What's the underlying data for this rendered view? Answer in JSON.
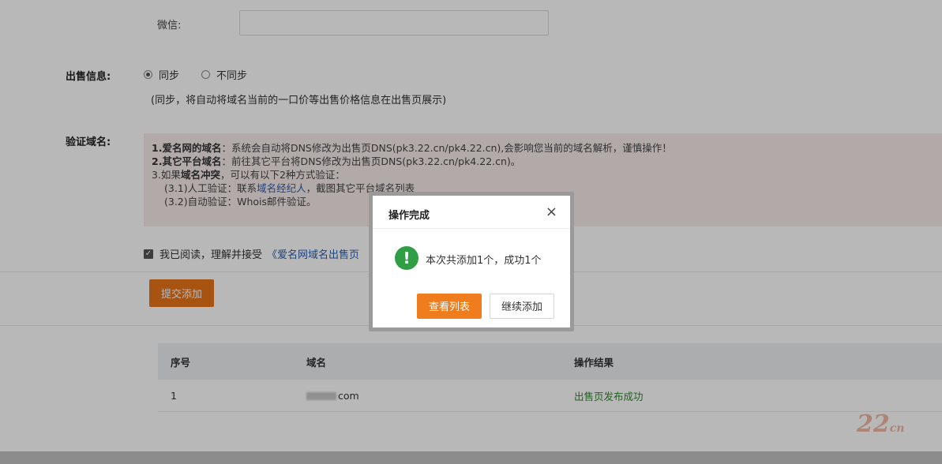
{
  "form": {
    "wechat_label": "微信:",
    "wechat_value": "",
    "sale_info_label": "出售信息:",
    "radio_sync": "同步",
    "radio_nosync": "不同步",
    "sale_note": "(同步，将自动将域名当前的一口价等出售价格信息在出售页展示)",
    "verify_label": "验证域名:",
    "verify": {
      "l1_bold": "1.爱名网的域名",
      "l1_rest": "：系统会自动将DNS修改为出售页DNS(pk3.22.cn/pk4.22.cn),会影响您当前的域名解析，谨慎操作！",
      "l2_bold": "2.其它平台域名",
      "l2_rest": "：前往其它平台将DNS修改为出售页DNS(pk3.22.cn/pk4.22.cn)。",
      "l3_a": "3.如果",
      "l3_bold": "域名冲突",
      "l3_b": "，可以有以下2种方式验证：",
      "l4_a": "(3.1)人工验证：联系",
      "l4_link": "域名经纪人",
      "l4_b": "，截图其它平台域名列表",
      "l5": "(3.2)自动验证：Whois邮件验证。"
    },
    "agree_text": "我已阅读，理解并接受",
    "agree_link": "《爱名网域名出售页",
    "submit_label": "提交添加"
  },
  "table": {
    "headers": [
      "序号",
      "域名",
      "操作结果"
    ],
    "rows": [
      {
        "index": "1",
        "domain_suffix": "com",
        "result": "出售页发布成功"
      }
    ]
  },
  "watermark": {
    "main": "22",
    "suffix": "cn"
  },
  "dialog": {
    "title": "操作完成",
    "close": "×",
    "message": "本次共添加1个，成功1个",
    "icon_glyph": "!",
    "primary_label": "查看列表",
    "secondary_label": "继续添加"
  },
  "colors": {
    "accent": "#f07d1d",
    "success": "#2f9e44",
    "link": "#2a5db0"
  }
}
